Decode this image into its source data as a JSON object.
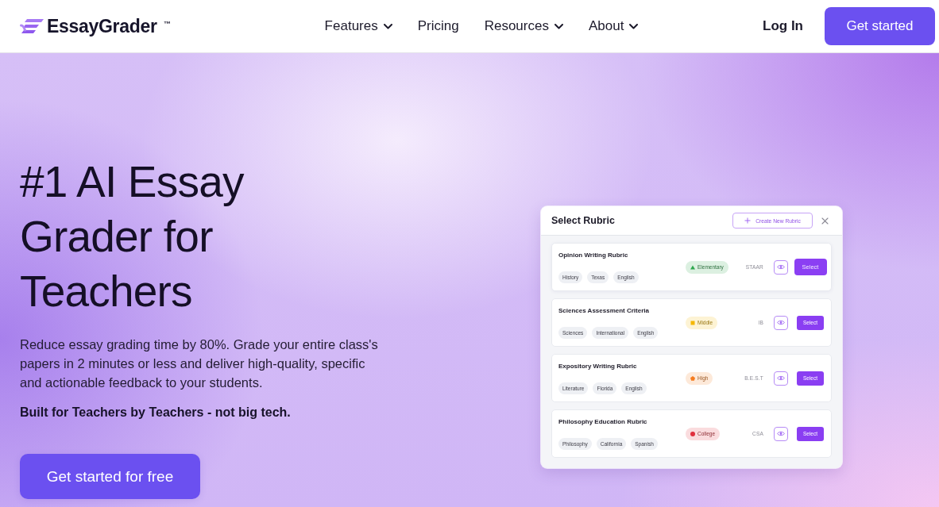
{
  "header": {
    "logo": "EssayGrader$^{™}$",
    "nav": [
      {
        "label": "Features",
        "dropdown": true
      },
      {
        "label": "Pricing",
        "dropdown": false
      },
      {
        "label": "Resources",
        "dropdown": true
      },
      {
        "label": "About",
        "dropdown": true
      }
    ],
    "login": "Log In",
    "cta": "Get started"
  },
  "hero": {
    "title": "#1 AI Essay Grader for Teachers",
    "description": "Reduce essay grading time by 80%. Grade your entire class's papers in 2 minutes or less and deliver high-quality, specific and actionable feedback to your students.",
    "tagline": "Built for Teachers by Teachers - not big tech.",
    "cta": "Get started for free"
  },
  "rubric_dialog": {
    "title": "Select Rubric",
    "create_button": "Create New Rubric",
    "rubrics": [
      {
        "name": "Opinion Writing Rubric",
        "tags": [
          "History",
          "Texas",
          "English"
        ],
        "level": {
          "label": "Elementary",
          "kind": "triangle",
          "color": "#2fa84f"
        },
        "exam": "STAAR",
        "select": "Select",
        "hovered": true
      },
      {
        "name": "Sciences Assessment Criteria",
        "tags": [
          "Sciences",
          "International",
          "English"
        ],
        "level": {
          "label": "Middle",
          "kind": "square",
          "color": "#f5b700"
        },
        "exam": "IB",
        "select": "Select",
        "hovered": false
      },
      {
        "name": "Expository Writing Rubric",
        "tags": [
          "Literature",
          "Florida",
          "English"
        ],
        "level": {
          "label": "High",
          "kind": "pentagon",
          "color": "#f57c1f"
        },
        "exam": "B.E.S.T",
        "select": "Select",
        "hovered": false
      },
      {
        "name": "Philosophy Education Rubric",
        "tags": [
          "Philosophy",
          "California",
          "Spanish"
        ],
        "level": {
          "label": "College",
          "kind": "circle",
          "color": "#e0303e"
        },
        "exam": "CSA",
        "select": "Select",
        "hovered": false
      }
    ]
  }
}
